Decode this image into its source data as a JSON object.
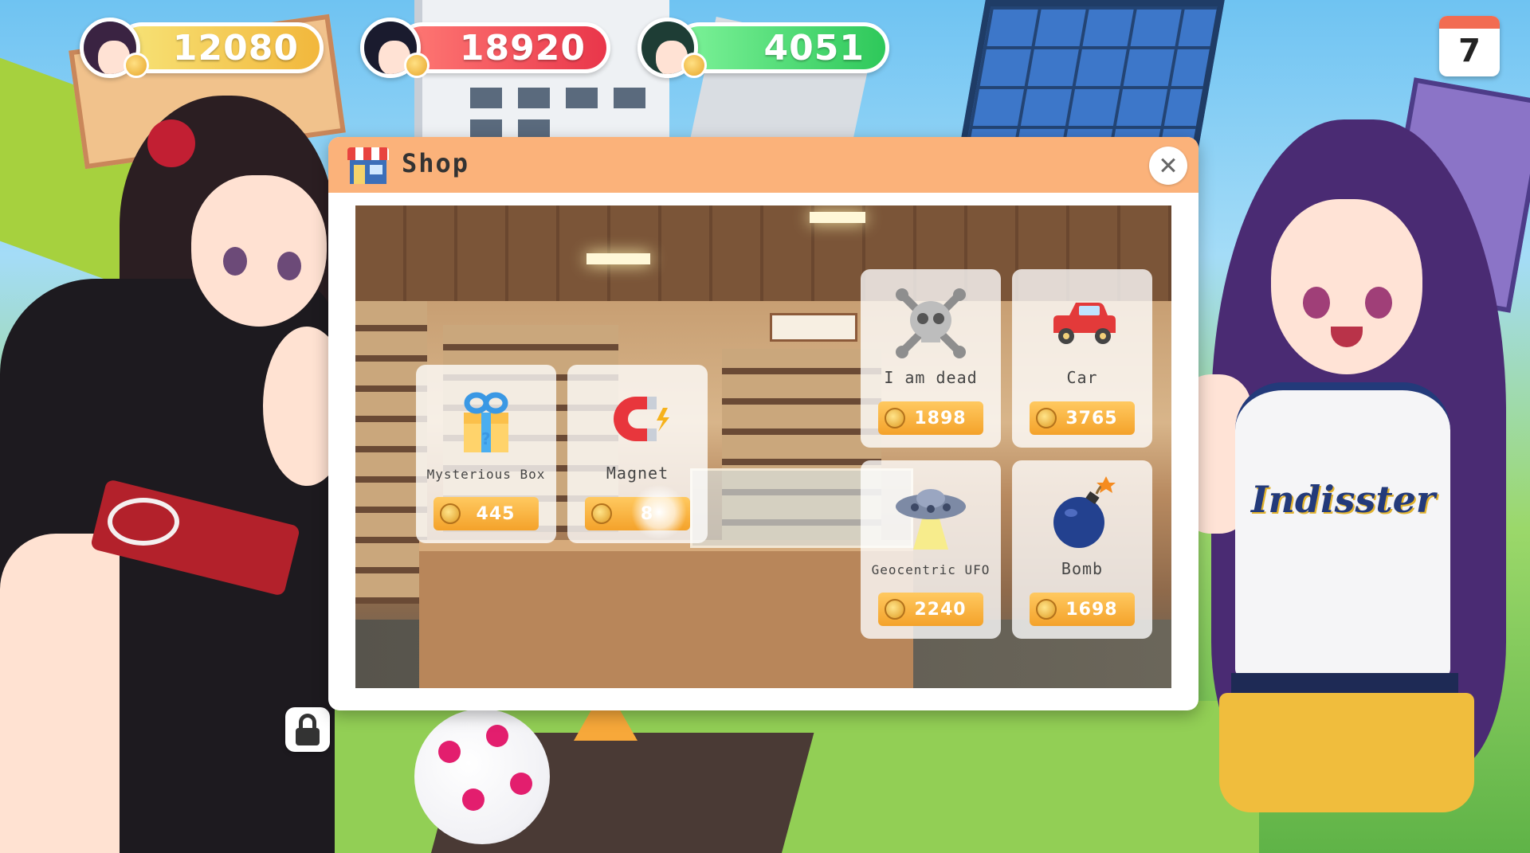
{
  "hud": {
    "players": [
      {
        "coins": "12080",
        "bar_color": "#f2b73c"
      },
      {
        "coins": "18920",
        "bar_color": "#e9364a"
      },
      {
        "coins": "4051",
        "bar_color": "#2ec85a"
      }
    ],
    "day": "7"
  },
  "shop": {
    "title": "Shop",
    "header_color": "#fbb27a",
    "items": [
      {
        "name": "Mysterious Box",
        "price": "445",
        "icon": "gift-box-icon"
      },
      {
        "name": "Magnet",
        "price": "8",
        "icon": "magnet-icon"
      },
      {
        "name": "I am dead",
        "price": "1898",
        "icon": "skull-crossbones-icon"
      },
      {
        "name": "Car",
        "price": "3765",
        "icon": "car-icon"
      },
      {
        "name": "Geocentric UFO",
        "price": "2240",
        "icon": "ufo-icon"
      },
      {
        "name": "Bomb",
        "price": "1698",
        "icon": "bomb-icon"
      }
    ]
  },
  "colors": {
    "price_button": "#f4a22a",
    "coin": "#e09a22"
  }
}
